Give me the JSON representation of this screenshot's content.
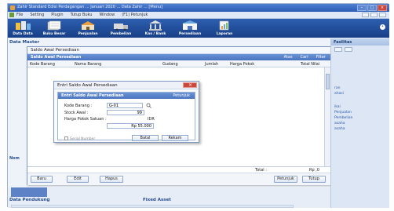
{
  "window": {
    "title": "Zahir Standard Edisi Perdagangan ... Januari 2020 ... Data Zahir ... [Menu]"
  },
  "menu": {
    "items": [
      "File",
      "Setting",
      "Plugin",
      "Tutup Buku",
      "Window",
      "(F1) Petunjuk"
    ]
  },
  "toolbar": {
    "buttons": [
      "Data Data",
      "Buku Besar",
      "Penjualan",
      "Pembelian",
      "Kas / Bank",
      "Persediaan",
      "Laporan"
    ]
  },
  "main": {
    "data_master_label": "Data Master",
    "nomor_label": "Nom",
    "data_pendukung_label": "Data Pendukung",
    "fixed_asset_label": "Fixed Asset"
  },
  "sidepanel": {
    "header": "Fasilitas",
    "links": [
      "ran",
      "ahasi",
      "ikai",
      "Penjualan",
      "Pembelian",
      "asaha",
      "asaha"
    ]
  },
  "saldo_window": {
    "title": "Saldo Awal Persediaan",
    "band_title": "Saldo Awal Persediaan",
    "band_buttons": [
      "Atas",
      "Cari",
      "Filter"
    ],
    "columns": [
      "Kode Barang",
      "Nama Barang",
      "Gudang",
      "Jumlah",
      "Harga Pokok",
      "Total Nilai"
    ],
    "total_label": "Total :",
    "total_value": "Rp ,0",
    "buttons": {
      "baru": "Baru",
      "edit": "Edit",
      "hapus": "Hapus",
      "petunjuk": "Petunjuk",
      "tutup": "Tutup"
    }
  },
  "dialog": {
    "title": "Entri Saldo Awal Persediaan",
    "band_title": "Entri Saldo Awal Persediaan",
    "band_right": "Petunjuk",
    "kode_label": "Kode Barang :",
    "kode_value": "G-01",
    "stock_label": "Stock Awal :",
    "stock_value": "99",
    "harga_label": "Harga Pokok Satuan :",
    "harga_currency": "IDR",
    "harga_value": "Rp 55.000",
    "checkbox_label": "Serial Number",
    "batal": "Batal",
    "rekam": "Rekam"
  }
}
